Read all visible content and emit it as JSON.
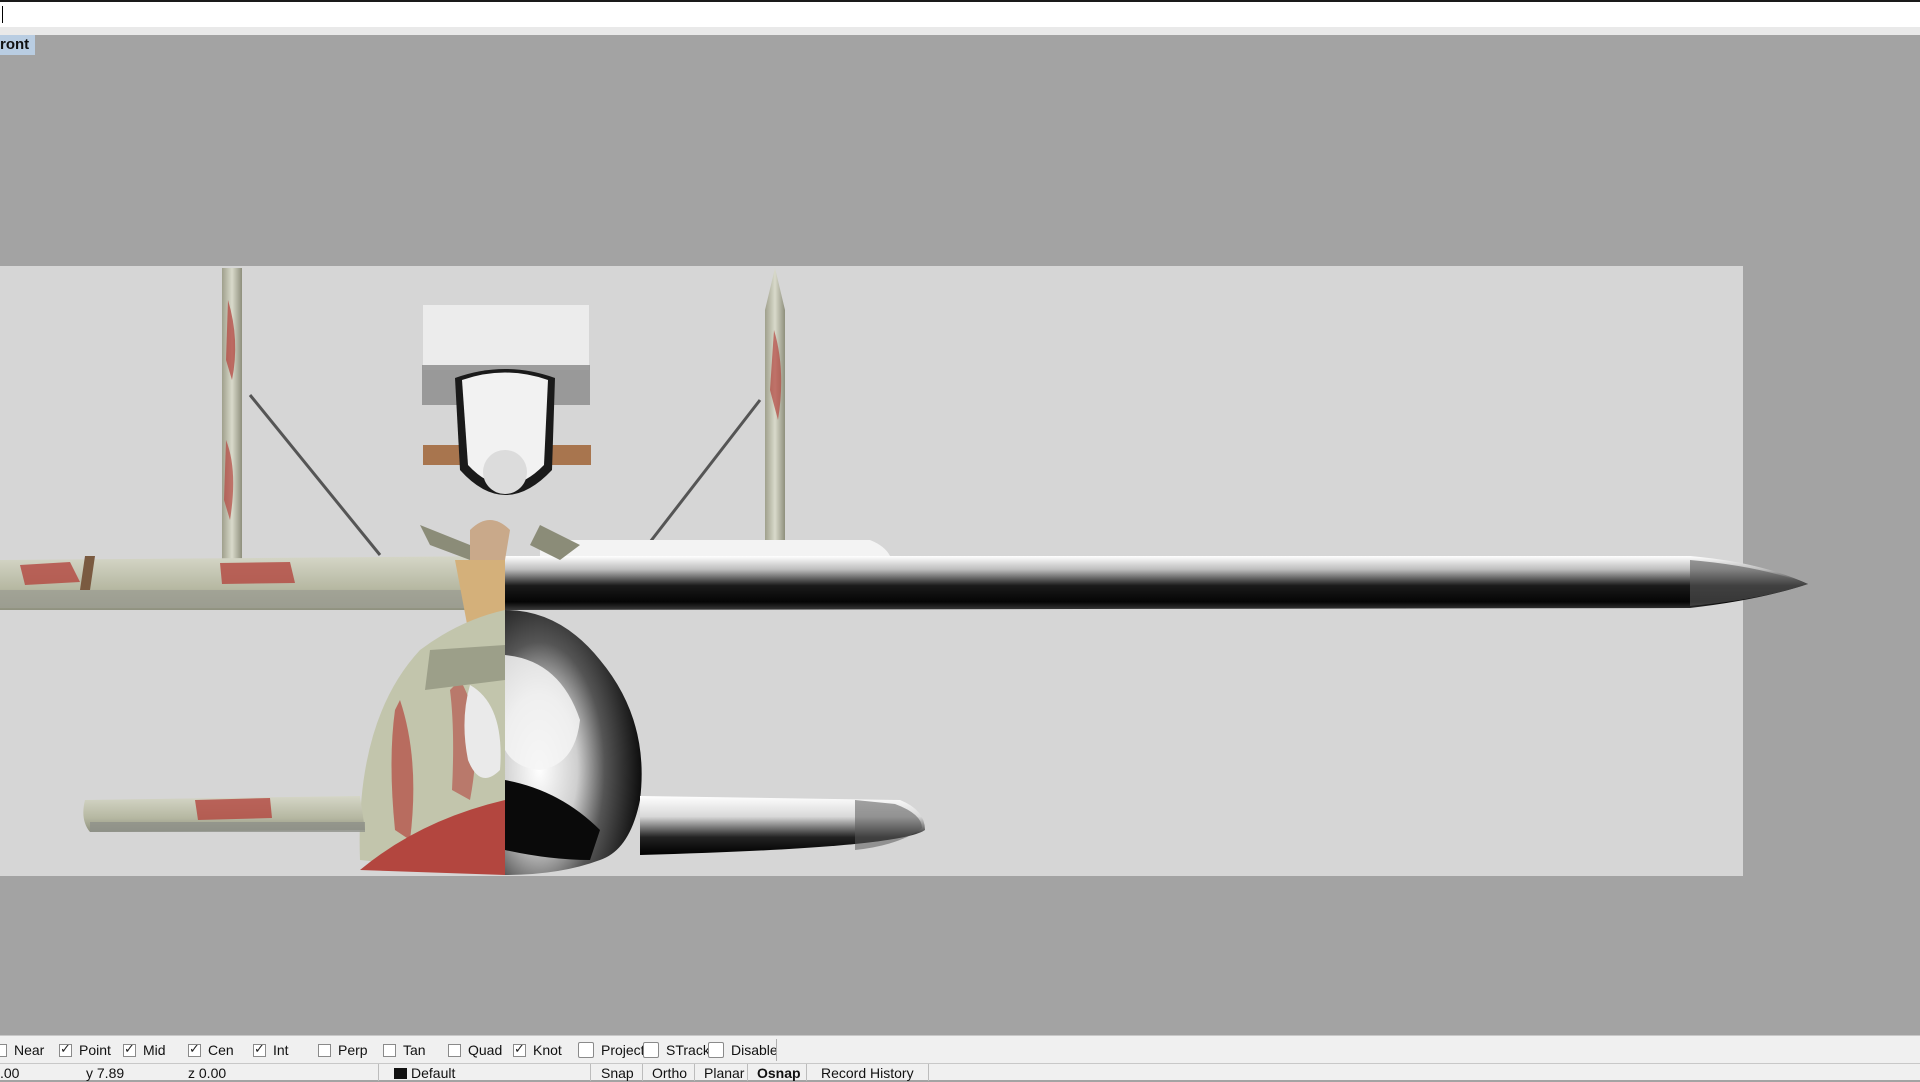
{
  "command_line": {
    "value": ""
  },
  "viewport": {
    "title": "ront"
  },
  "osnap": [
    {
      "label": "Near",
      "checked": false
    },
    {
      "label": "Point",
      "checked": true
    },
    {
      "label": "Mid",
      "checked": true
    },
    {
      "label": "Cen",
      "checked": true
    },
    {
      "label": "Int",
      "checked": true
    },
    {
      "label": "Perp",
      "checked": false
    },
    {
      "label": "Tan",
      "checked": false
    },
    {
      "label": "Quad",
      "checked": false
    },
    {
      "label": "Knot",
      "checked": true
    },
    {
      "label": "Project",
      "checked": false
    },
    {
      "label": "STrack",
      "checked": false
    },
    {
      "label": "Disable",
      "checked": false
    }
  ],
  "status": {
    "x": ".00",
    "y": "y 7.89",
    "z": "z 0.00",
    "layer": "Default",
    "buttons": [
      "Snap",
      "Ortho",
      "Planar",
      "Osnap",
      "Record History"
    ]
  },
  "colors": {
    "viewport_bg": "#a3a3a3",
    "background_bitmap": "#d6d6d6",
    "title_highlight": "#b9cde2",
    "camo_green": "#bfc3a8",
    "camo_red": "#b3463f"
  }
}
